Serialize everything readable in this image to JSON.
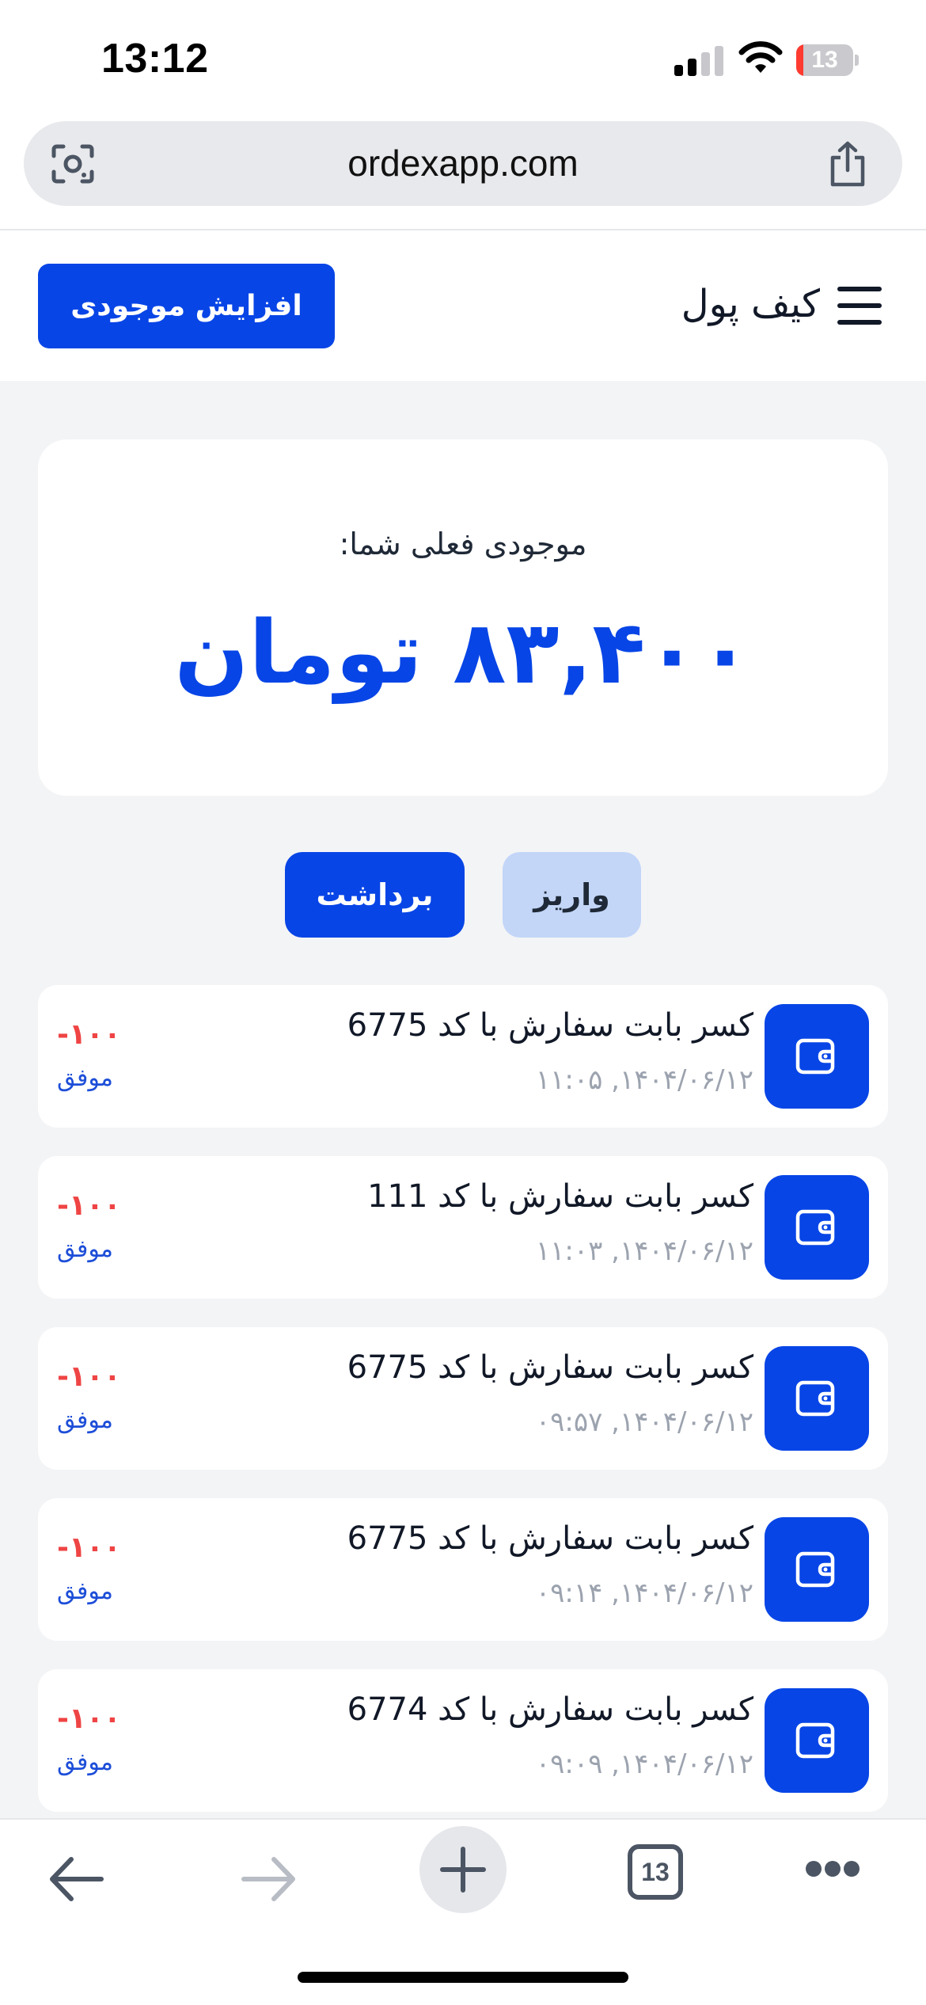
{
  "status_bar": {
    "time": "13:12",
    "battery_level": "13",
    "battery_fraction": 0.13,
    "signal_icon": "cellular-signal-icon",
    "wifi_icon": "wifi-icon"
  },
  "browser": {
    "url": "ordexapp.com",
    "left_icon": "visual-lookup-icon",
    "right_icon": "share-icon",
    "tab_count": "13"
  },
  "header": {
    "title": "کیف پول",
    "increase_button": "افزایش موجودی",
    "menu_icon": "hamburger-menu-icon"
  },
  "balance": {
    "label": "موجودی فعلی شما:",
    "value": "۸۳,۴۰۰ تومان"
  },
  "tabs": {
    "withdraw": "برداشت",
    "deposit": "واریز",
    "active": "withdraw"
  },
  "transactions": [
    {
      "title": "کسر بابت سفارش با کد 6775",
      "date": "۱۴۰۴/۰۶/۱۲, ۱۱:۰۵",
      "amount": "-۱۰۰",
      "status": "موفق"
    },
    {
      "title": "کسر بابت سفارش با کد 111",
      "date": "۱۴۰۴/۰۶/۱۲, ۱۱:۰۳",
      "amount": "-۱۰۰",
      "status": "موفق"
    },
    {
      "title": "کسر بابت سفارش با کد 6775",
      "date": "۱۴۰۴/۰۶/۱۲, ۰۹:۵۷",
      "amount": "-۱۰۰",
      "status": "موفق"
    },
    {
      "title": "کسر بابت سفارش با کد 6775",
      "date": "۱۴۰۴/۰۶/۱۲, ۰۹:۱۴",
      "amount": "-۱۰۰",
      "status": "موفق"
    },
    {
      "title": "کسر بابت سفارش با کد 6774",
      "date": "۱۴۰۴/۰۶/۱۲, ۰۹:۰۹",
      "amount": "-۱۰۰",
      "status": "موفق"
    }
  ],
  "colors": {
    "primary": "#0745e6",
    "deposit_tab_bg": "#c3d6f8",
    "negative_amount": "#ef4444",
    "status_success": "#1d4ed8",
    "battery_low": "#ff3b30"
  }
}
